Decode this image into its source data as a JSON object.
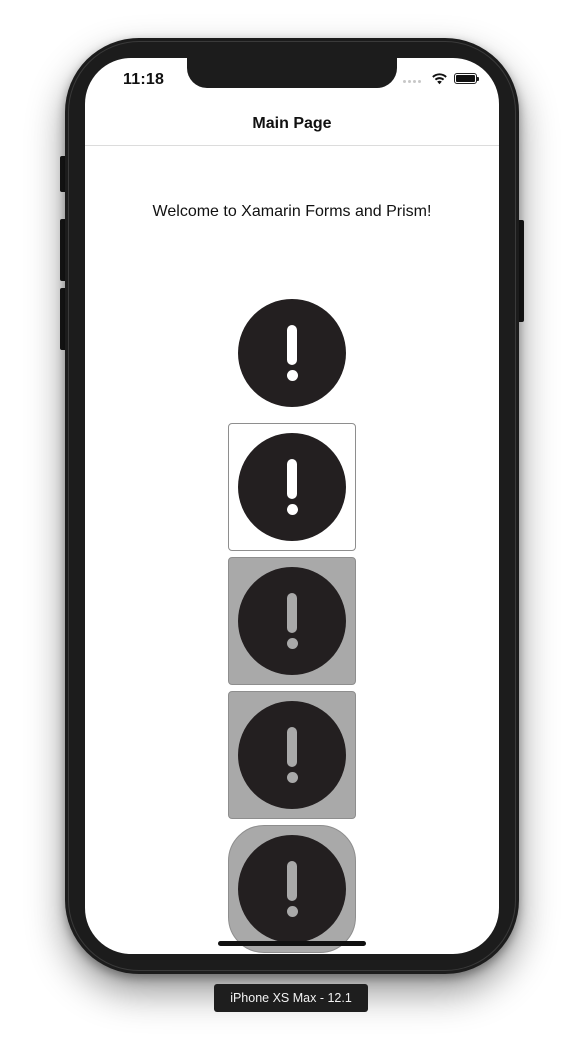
{
  "status_bar": {
    "time": "11:18",
    "icons": [
      "signal-dots-icon",
      "wifi-icon",
      "battery-icon"
    ]
  },
  "nav": {
    "title": "Main Page"
  },
  "main": {
    "welcome_text": "Welcome to Xamarin Forms and Prism!",
    "image_buttons": [
      {
        "icon": "alert-icon",
        "style": "plain",
        "glyph_color": "#ffffff"
      },
      {
        "icon": "alert-icon",
        "style": "bordered",
        "background": "#ffffff",
        "glyph_color": "#ffffff"
      },
      {
        "icon": "alert-icon",
        "style": "grey-background",
        "background": "#a9a9a9",
        "glyph_color": "#a9a9a9"
      },
      {
        "icon": "alert-icon",
        "style": "grey-background",
        "background": "#a9a9a9",
        "glyph_color": "#a9a9a9"
      },
      {
        "icon": "alert-icon",
        "style": "grey-rounded",
        "background": "#a9a9a9",
        "glyph_color": "#a9a9a9"
      }
    ]
  },
  "simulator": {
    "device_label": "iPhone XS Max - 12.1"
  },
  "colors": {
    "icon_fill": "#231f20",
    "button_grey": "#a9a9a9",
    "frame": "#1c1c1c"
  }
}
